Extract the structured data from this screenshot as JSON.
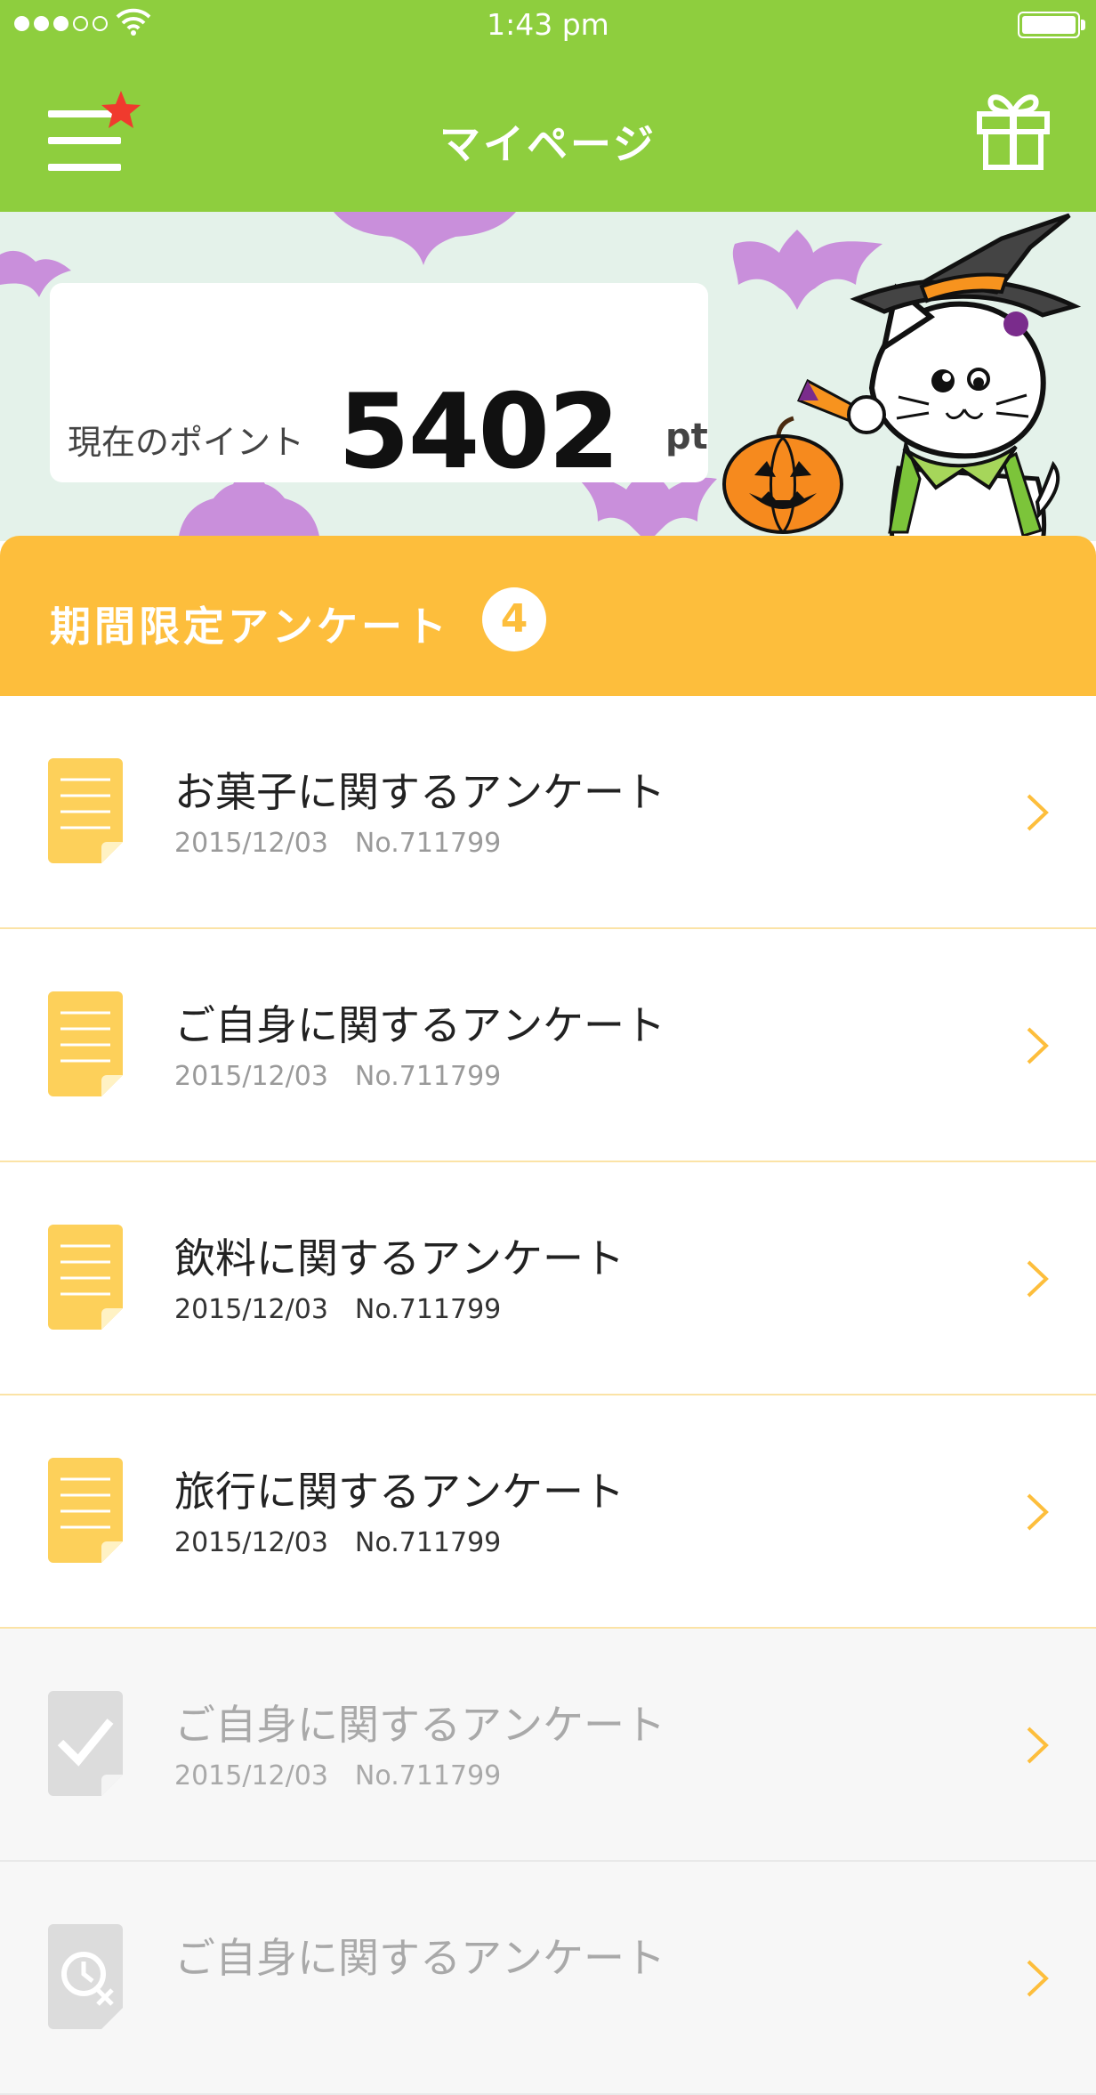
{
  "status_bar": {
    "time": "1:43 pm",
    "signal_bars": 3,
    "signal_total": 5
  },
  "nav": {
    "title": "マイページ",
    "menu_icon": "hamburger-menu-icon",
    "badge_icon": "star-icon",
    "gift_icon": "gift-icon"
  },
  "points": {
    "label": "現在のポイント",
    "value": "5402",
    "unit": "pt"
  },
  "section": {
    "title": "期間限定アンケート",
    "count": "4"
  },
  "surveys": [
    {
      "title": "お菓子に関するアンケート",
      "date": "2015/12/03",
      "number": "No.711799",
      "status": "open"
    },
    {
      "title": "ご自身に関するアンケート",
      "date": "2015/12/03",
      "number": "No.711799",
      "status": "open"
    },
    {
      "title": "飲料に関するアンケート",
      "date": "2015/12/03",
      "number": "No.711799",
      "status": "open"
    },
    {
      "title": "旅行に関するアンケート",
      "date": "2015/12/03",
      "number": "No.711799",
      "status": "open"
    },
    {
      "title": "ご自身に関するアンケート",
      "date": "2015/12/03",
      "number": "No.711799",
      "status": "completed"
    },
    {
      "title": "ご自身に関するアンケート",
      "date": "",
      "number": "",
      "status": "expired"
    }
  ],
  "colors": {
    "header_green": "#8ece3e",
    "section_orange": "#fdbe3c",
    "hero_bg": "#e4f2ea",
    "bat_purple": "#c98fdb",
    "star_red": "#f03a2e"
  }
}
